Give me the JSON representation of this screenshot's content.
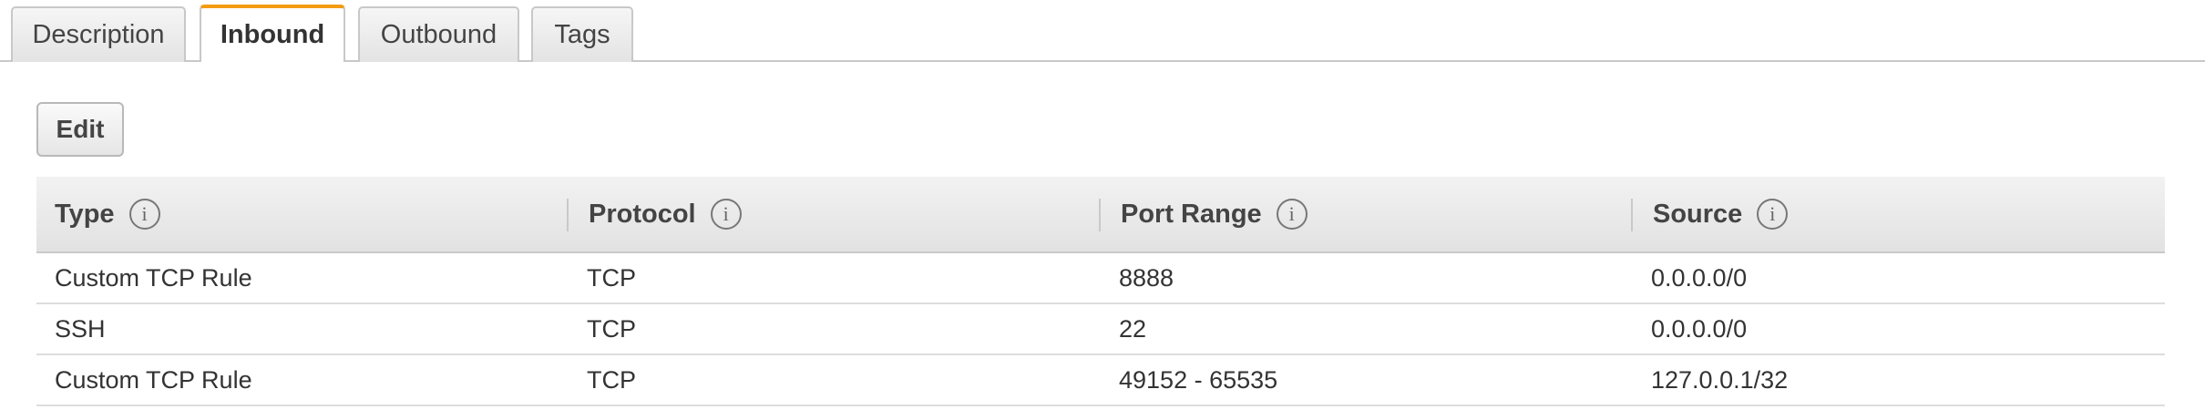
{
  "tabs": [
    {
      "label": "Description",
      "active": false
    },
    {
      "label": "Inbound",
      "active": true
    },
    {
      "label": "Outbound",
      "active": false
    },
    {
      "label": "Tags",
      "active": false
    }
  ],
  "toolbar": {
    "edit_label": "Edit"
  },
  "table": {
    "columns": [
      "Type",
      "Protocol",
      "Port Range",
      "Source"
    ],
    "info_icon_glyph": "i",
    "rows": [
      [
        "Custom TCP Rule",
        "TCP",
        "8888",
        "0.0.0.0/0"
      ],
      [
        "SSH",
        "TCP",
        "22",
        "0.0.0.0/0"
      ],
      [
        "Custom TCP Rule",
        "TCP",
        "49152 - 65535",
        "127.0.0.1/32"
      ]
    ]
  },
  "colors": {
    "active_tab_accent": "#f39c12"
  }
}
